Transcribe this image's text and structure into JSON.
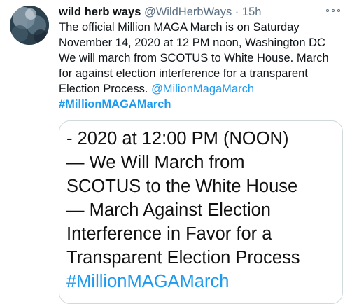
{
  "tweet": {
    "author_name": "wild herb ways",
    "author_handle": "@WildHerbWays",
    "separator": "·",
    "time": "15h",
    "text_lines": [
      "The official Million MAGA March is on Saturday",
      "November 14, 2020 at 12 PM noon, Washington DC",
      "We will march from SCOTUS to White House. March",
      "for against election interference for a transparent"
    ],
    "text_last_prefix": "Election Process. ",
    "mention": "@MilionMagaMarch",
    "hashtag": "#MillionMAGAMarch"
  },
  "media": {
    "lines": [
      "- 2020 at 12:00 PM (NOON)",
      "— We Will March from",
      "SCOTUS to the White House",
      "— March Against Election",
      "Interference in Favor for a",
      "Transparent Election Process"
    ],
    "hashtag": "#MillionMAGAMarch"
  },
  "icons": {
    "more": "more-options-icon",
    "avatar": "profile-avatar"
  }
}
